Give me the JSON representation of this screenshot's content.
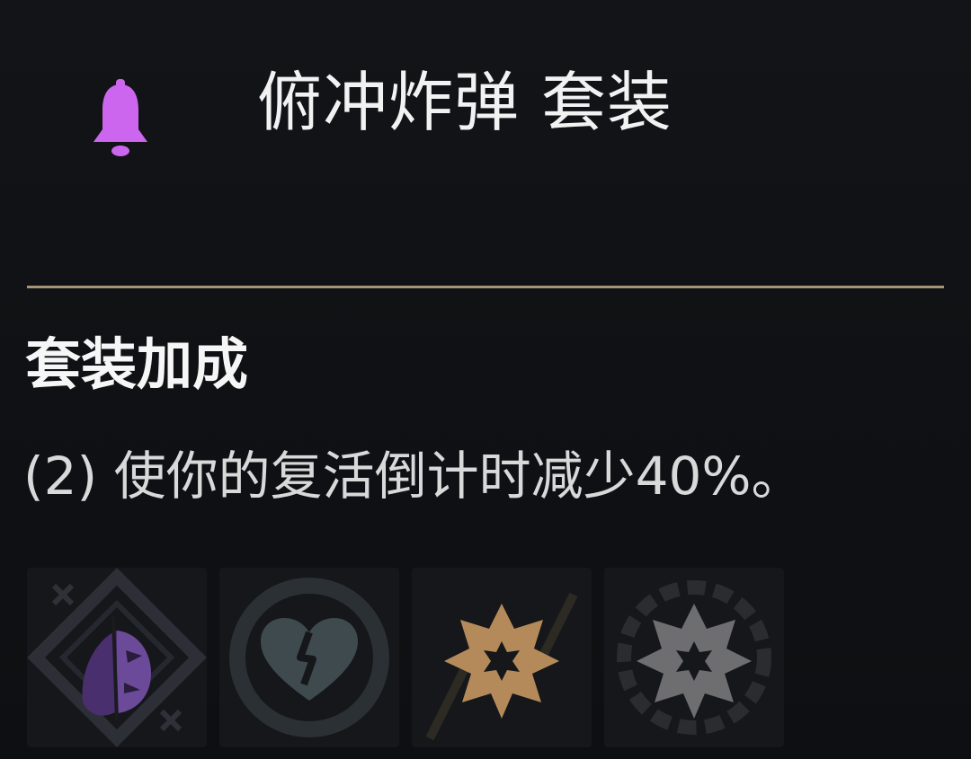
{
  "header": {
    "icon": "bell-icon",
    "title": "俯冲炸弹 套装",
    "icon_color": "#cc66ee"
  },
  "set_bonus": {
    "heading": "套装加成",
    "line": "(2) 使你的复活倒计时减少40%。"
  },
  "items": [
    {
      "icon": "fox-mask-emblem-icon",
      "color": "#7a55aa"
    },
    {
      "icon": "broken-heart-icon",
      "color": "#3f4a4f"
    },
    {
      "icon": "explosion-burst-icon",
      "color": "#b58a5a"
    },
    {
      "icon": "gear-burst-icon",
      "color": "#6e6e70"
    }
  ],
  "colors": {
    "background": "#0f1114",
    "divider": "#a59677",
    "title_text": "#f2f2f2",
    "body_text": "#d9d9d9"
  }
}
